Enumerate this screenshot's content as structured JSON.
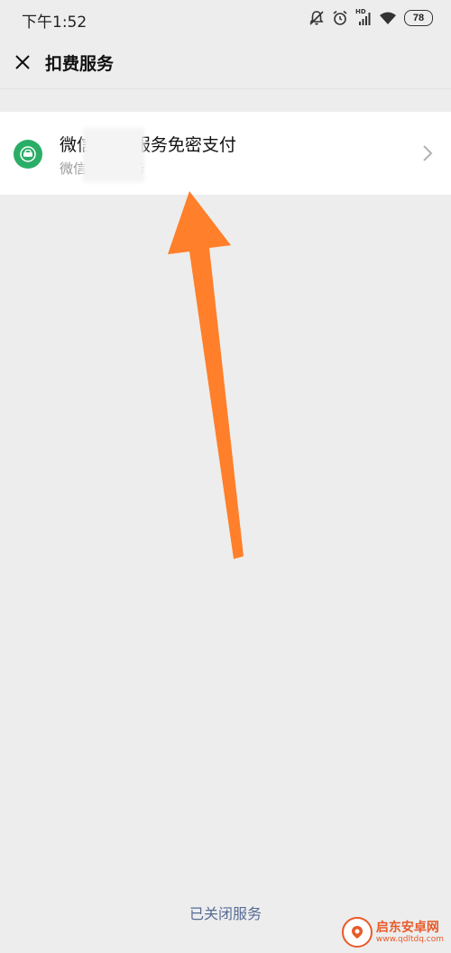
{
  "status_bar": {
    "time": "下午1:52",
    "battery": "78",
    "hd_label": "HD",
    "icons": [
      "mute-bell-icon",
      "alarm-icon",
      "signal-icon",
      "wifi-icon",
      "battery-icon"
    ]
  },
  "nav": {
    "title": "扣费服务",
    "close_icon": "close-icon"
  },
  "service": {
    "title": "微信▒▒▒服务免密支付",
    "subtitle": "微信▒▒▒服务",
    "icon": "car-payment-icon",
    "icon_color": "#2aae67"
  },
  "footer": {
    "closed_services_label": "已关闭服务",
    "link_color": "#576b95"
  },
  "annotation": {
    "arrow_color": "#ff7f2a"
  },
  "watermark": {
    "name": "启东安卓网",
    "url": "www.qdltdq.com"
  }
}
